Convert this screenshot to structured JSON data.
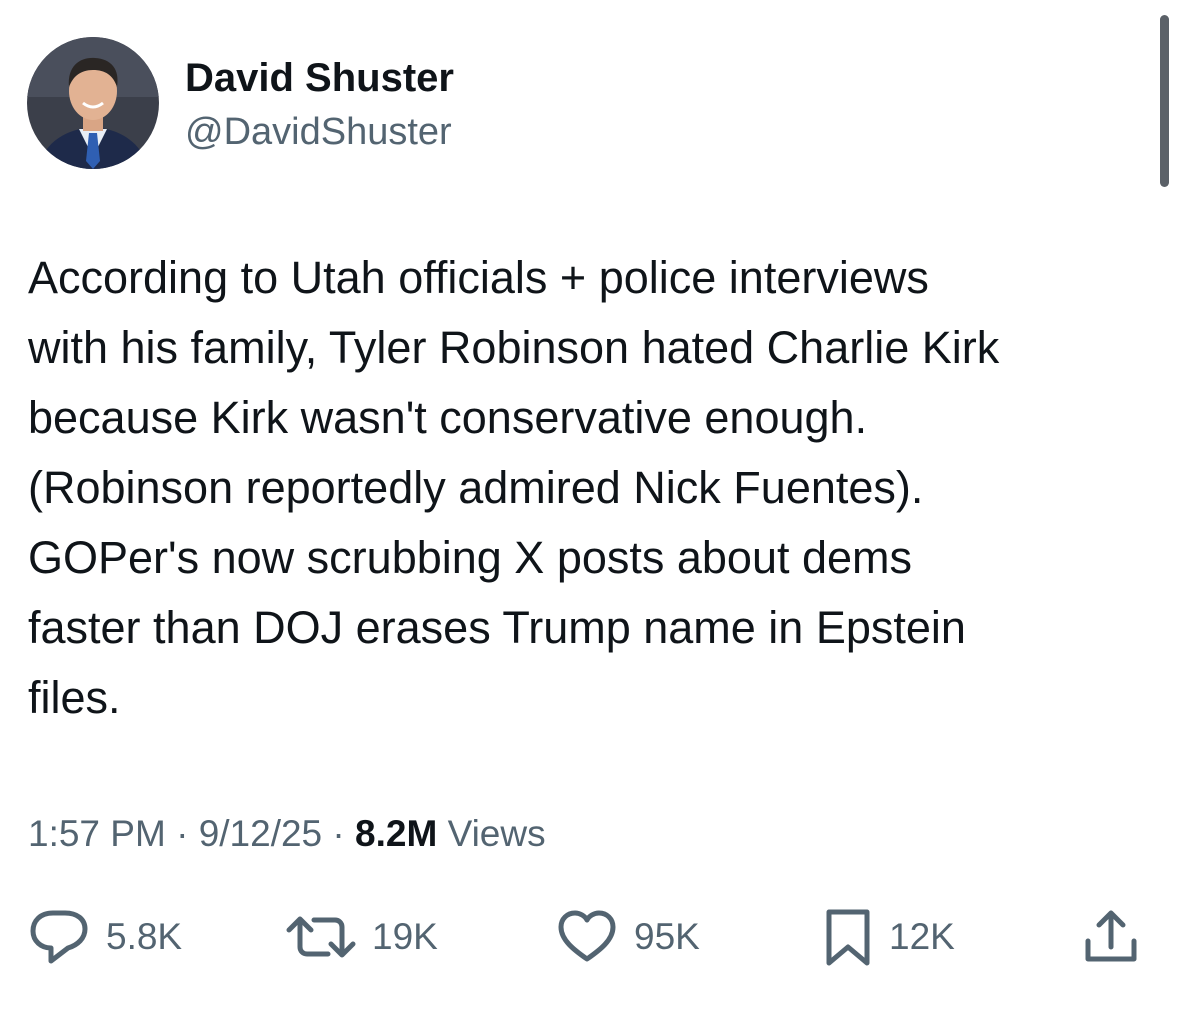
{
  "author": {
    "display_name": "David Shuster",
    "handle": "@DavidShuster",
    "avatar_icon": "profile-photo"
  },
  "tweet": {
    "text": "According to Utah officials + police interviews\nwith his family, Tyler Robinson hated Charlie Kirk\nbecause Kirk wasn't conservative enough.\n(Robinson reportedly admired Nick Fuentes).\nGOPer's now scrubbing X posts about dems\nfaster than DOJ erases Trump name in Epstein\nfiles."
  },
  "meta": {
    "time": "1:57 PM",
    "separator": " · ",
    "date": "9/12/25",
    "views_count": "8.2M",
    "views_label": " Views"
  },
  "actions": {
    "reply": {
      "icon": "reply-icon",
      "count": "5.8K"
    },
    "repost": {
      "icon": "repost-icon",
      "count": "19K"
    },
    "like": {
      "icon": "heart-icon",
      "count": "95K"
    },
    "bookmark": {
      "icon": "bookmark-icon",
      "count": "12K"
    },
    "share": {
      "icon": "share-icon"
    }
  },
  "colors": {
    "text_primary": "#0f1419",
    "text_secondary": "#536471",
    "scrollbar": "#5b6168"
  }
}
